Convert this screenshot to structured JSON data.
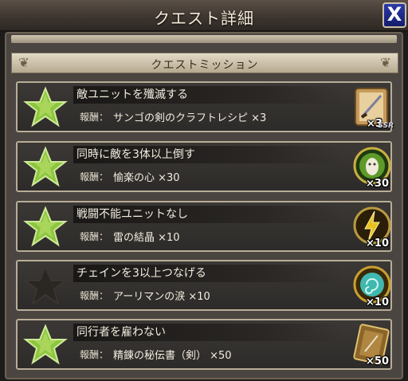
{
  "header": {
    "title": "クエスト詳細",
    "close_label": "X"
  },
  "section": {
    "title": "クエストミッション"
  },
  "missions": [
    {
      "name": "敵ユニットを殲滅する",
      "reward_label": "報酬：",
      "reward": "サンゴの剣のクラフトレシピ ×3",
      "quantity": "×3",
      "rarity": "SSR",
      "completed": true,
      "icon": "recipe-scroll-icon"
    },
    {
      "name": "同時に敵を3体以上倒す",
      "reward_label": "報酬：",
      "reward": "愉楽の心 ×30",
      "quantity": "×30",
      "completed": true,
      "icon": "mask-orb-icon"
    },
    {
      "name": "戦闘不能ユニットなし",
      "reward_label": "報酬：",
      "reward": "雷の結晶 ×10",
      "quantity": "×10",
      "completed": true,
      "icon": "thunder-crystal-icon"
    },
    {
      "name": "チェインを3以上つなげる",
      "reward_label": "報酬：",
      "reward": "アーリマンの涙 ×10",
      "quantity": "×10",
      "completed": false,
      "icon": "tear-orb-icon"
    },
    {
      "name": "同行者を雇わない",
      "reward_label": "報酬：",
      "reward": "精錬の秘伝書（剣） ×50",
      "quantity": "×50",
      "completed": true,
      "icon": "secret-book-icon"
    }
  ],
  "colors": {
    "star_complete": "#8cc63f",
    "star_incomplete": "#2a2622",
    "close_button": "#1e2a90"
  }
}
